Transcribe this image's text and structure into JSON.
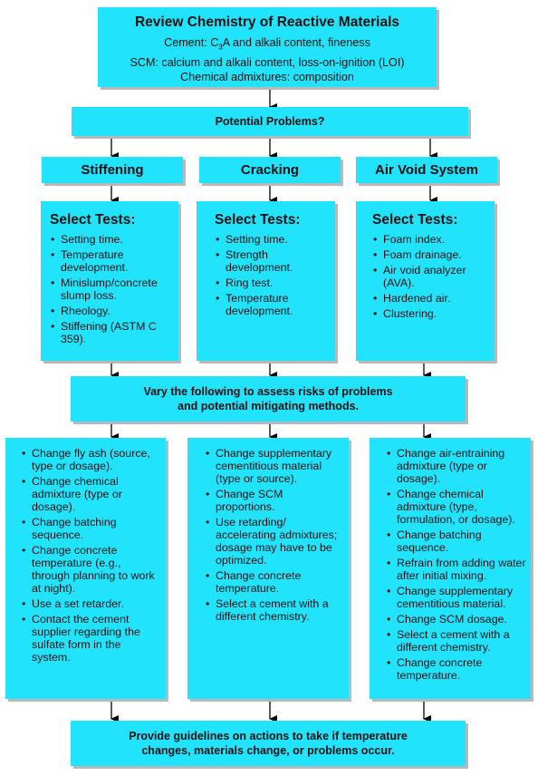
{
  "review_box": {
    "title": "Review Chemistry of Reactive Materials",
    "line_cement_prefix": "Cement: C",
    "line_cement_sub": "3",
    "line_cement_suffix": "A and alkali content, fineness",
    "line_scm": "SCM: calcium and alkali content, loss-on-ignition (LOI)",
    "line_admix": "Chemical admixtures: composition"
  },
  "potential_problems": "Potential Problems?",
  "problems": [
    {
      "name": "Stiffening",
      "tests_title": "Select Tests:",
      "tests": [
        "Setting time.",
        "Temperature development.",
        "Minislump/concrete slump loss.",
        "Rheology.",
        "Stiffening (ASTM C 359)."
      ],
      "actions": [
        "Change fly ash (source, type or dosage).",
        "Change chemical admixture (type or dosage).",
        "Change batching sequence.",
        "Change concrete temperature (e.g., through planning to work at night).",
        "Use a set retarder.",
        "Contact the cement supplier regarding the sulfate form in the system."
      ]
    },
    {
      "name": "Cracking",
      "tests_title": "Select Tests:",
      "tests": [
        "Setting time.",
        "Strength development.",
        "Ring test.",
        "Temperature development."
      ],
      "actions": [
        "Change supplementary cementitious material (type or source).",
        "Change SCM proportions.",
        "Use retarding/ accelerating admixtures; dosage may have to be optimized.",
        "Change concrete temperature.",
        "Select a cement with a different chemistry."
      ]
    },
    {
      "name": "Air Void System",
      "tests_title": "Select Tests:",
      "tests": [
        "Foam index.",
        "Foam drainage.",
        "Air void analyzer (AVA).",
        "Hardened air.",
        "Clustering."
      ],
      "actions": [
        "Change air-entraining admixture (type or dosage).",
        "Change chemical admixture (type, formulation, or dosage).",
        "Change batching sequence.",
        "Refrain from adding water after initial mixing.",
        "Change supplementary cementitious material.",
        "Change SCM dosage.",
        "Select a cement with a different chemistry.",
        "Change concrete temperature."
      ]
    }
  ],
  "vary_box": {
    "line1": "Vary the following to assess risks of problems",
    "line2": "and potential mitigating methods."
  },
  "guidelines_box": {
    "line1": "Provide guidelines on actions to take if temperature",
    "line2": "changes, materials change, or problems occur."
  },
  "colors": {
    "box_fill": "#22e3fc",
    "shadow": "#b9b9b9",
    "text": "#111111"
  }
}
